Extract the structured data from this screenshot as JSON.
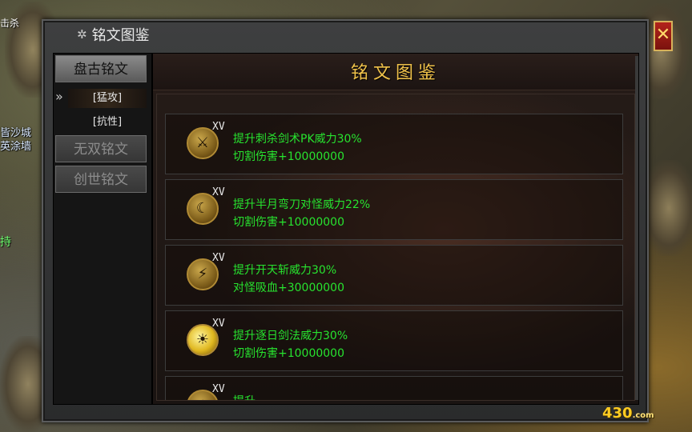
{
  "window": {
    "title": "铭文图鉴",
    "close_label": "✕"
  },
  "panel": {
    "title": "铭文图鉴"
  },
  "sidebar": {
    "tabs": [
      {
        "label": "盘古铭文",
        "state": "active"
      },
      {
        "label": "无双铭文",
        "state": "disabled"
      },
      {
        "label": "创世铭文",
        "state": "disabled"
      }
    ],
    "subtabs": [
      {
        "label": "[猛攻]",
        "state": "active"
      },
      {
        "label": "[抗性]",
        "state": "normal"
      }
    ],
    "selected_marker": "»"
  },
  "items": [
    {
      "icon": "blade-rune-icon",
      "level": "XV",
      "line1": "提升刺杀剑术PK威力30%",
      "line2": "切割伤害+10000000"
    },
    {
      "icon": "crescent-blade-icon",
      "level": "XV",
      "line1": "提升半月弯刀对怪威力22%",
      "line2": "切割伤害+10000000"
    },
    {
      "icon": "sky-slash-icon",
      "level": "XV",
      "line1": "提升开天斩威力30%",
      "line2": "对怪吸血+30000000"
    },
    {
      "icon": "sun-sword-icon",
      "level": "XV",
      "line1": "提升逐日剑法威力30%",
      "line2": "切割伤害+10000000"
    },
    {
      "icon": "fire-rune-icon",
      "level": "XV",
      "line1": "提升...",
      "line2": ""
    }
  ],
  "background": {
    "top_left_text": "击杀",
    "left_texts": [
      "皆沙城",
      "英涂墙"
    ],
    "left_green": "持"
  },
  "logo": {
    "text": "430",
    "suffix": ".com"
  },
  "colors": {
    "accent_gold": "#f0c24a",
    "effect_green": "#27e32f",
    "close_red": "#b3241b"
  }
}
